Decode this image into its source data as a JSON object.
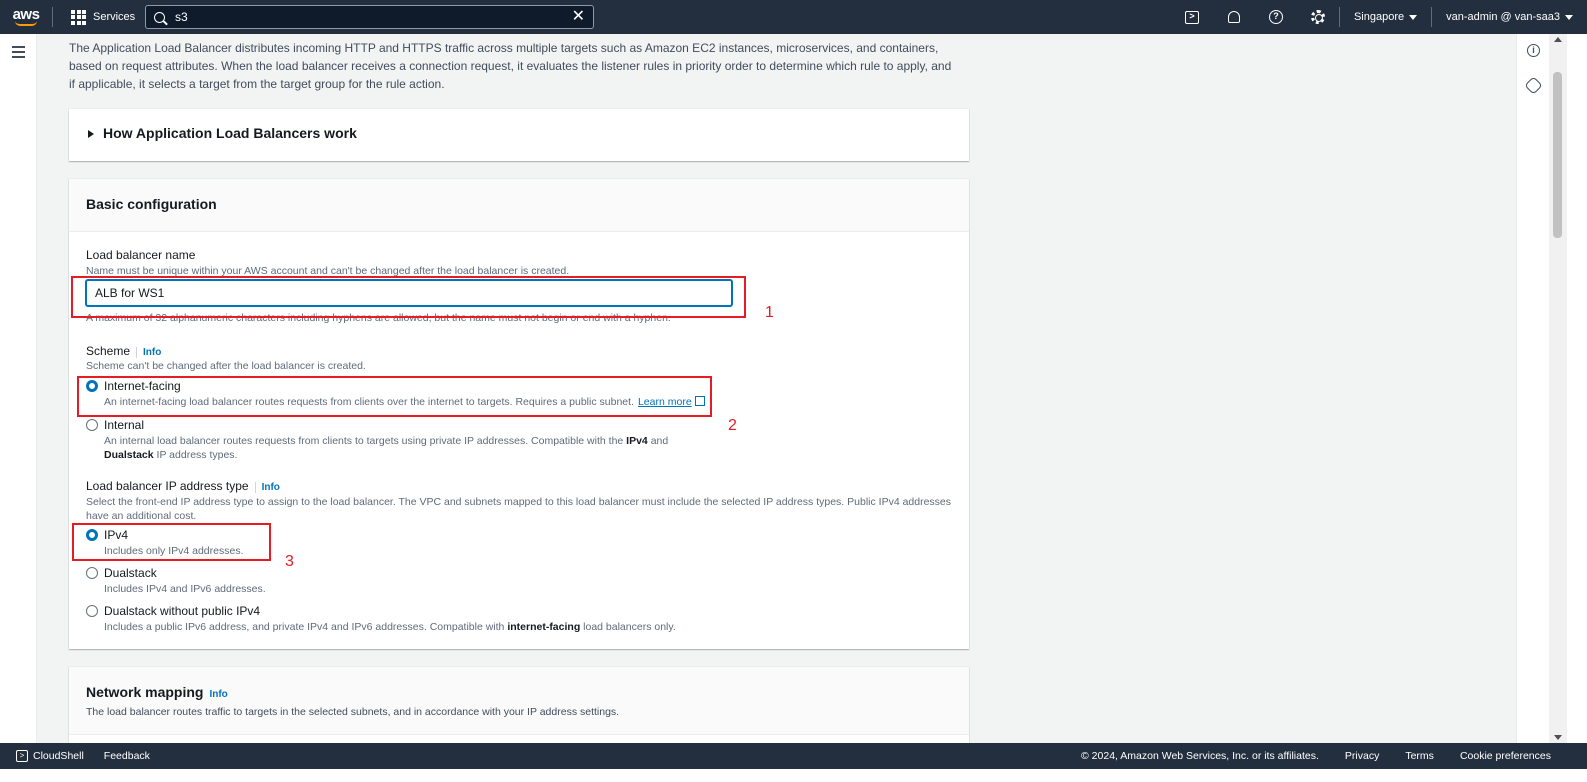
{
  "nav": {
    "logo": "aws",
    "services": "Services",
    "search_value": "s3",
    "region": "Singapore",
    "account": "van-admin @ van-saa3",
    "icons": [
      "cloudshell-icon",
      "notifications-icon",
      "help-icon",
      "settings-icon"
    ]
  },
  "intro": "The Application Load Balancer distributes incoming HTTP and HTTPS traffic across multiple targets such as Amazon EC2 instances, microservices, and containers, based on request attributes. When the load balancer receives a connection request, it evaluates the listener rules in priority order to determine which rule to apply, and if applicable, it selects a target from the target group for the rule action.",
  "how_section": {
    "title": "How Application Load Balancers work"
  },
  "basic": {
    "title": "Basic configuration",
    "name_label": "Load balancer name",
    "name_desc": "Name must be unique within your AWS account and can't be changed after the load balancer is created.",
    "name_value": "ALB for WS1",
    "name_hint": "A maximum of 32 alphanumeric characters including hyphens are allowed, but the name must not begin or end with a hyphen.",
    "scheme_label": "Scheme",
    "info": "Info",
    "scheme_desc": "Scheme can't be changed after the load balancer is created.",
    "scheme_options": [
      {
        "label": "Internet-facing",
        "desc": "An internet-facing load balancer routes requests from clients over the internet to targets. Requires a public subnet.",
        "link": "Learn more",
        "selected": true
      },
      {
        "label": "Internal",
        "desc_prefix": "An internal load balancer routes requests from clients to targets using private IP addresses. Compatible with the ",
        "desc_b1": "IPv4",
        "desc_mid": " and ",
        "desc_b2": "Dualstack",
        "desc_suffix": " IP address types.",
        "selected": false
      }
    ],
    "ip_label": "Load balancer IP address type",
    "ip_desc": "Select the front-end IP address type to assign to the load balancer. The VPC and subnets mapped to this load balancer must include the selected IP address types. Public IPv4 addresses have an additional cost.",
    "ip_options": [
      {
        "label": "IPv4",
        "desc": "Includes only IPv4 addresses.",
        "selected": true
      },
      {
        "label": "Dualstack",
        "desc": "Includes IPv4 and IPv6 addresses.",
        "selected": false
      },
      {
        "label": "Dualstack without public IPv4",
        "desc_prefix": "Includes a public IPv6 address, and private IPv4 and IPv6 addresses. Compatible with ",
        "desc_b": "internet-facing",
        "desc_suffix": " load balancers only.",
        "selected": false
      }
    ]
  },
  "network": {
    "title": "Network mapping",
    "info": "Info",
    "desc": "The load balancer routes traffic to targets in the selected subnets, and in accordance with your IP address settings."
  },
  "annotations": [
    "1",
    "2",
    "3"
  ],
  "footer": {
    "cloudshell": "CloudShell",
    "feedback": "Feedback",
    "copyright": "© 2024, Amazon Web Services, Inc. or its affiliates.",
    "privacy": "Privacy",
    "terms": "Terms",
    "cookies": "Cookie preferences"
  },
  "colors": {
    "nav_bg": "#232f3e",
    "accent": "#0073bb",
    "annotation": "#e51c23",
    "aws_orange": "#ff9900"
  }
}
